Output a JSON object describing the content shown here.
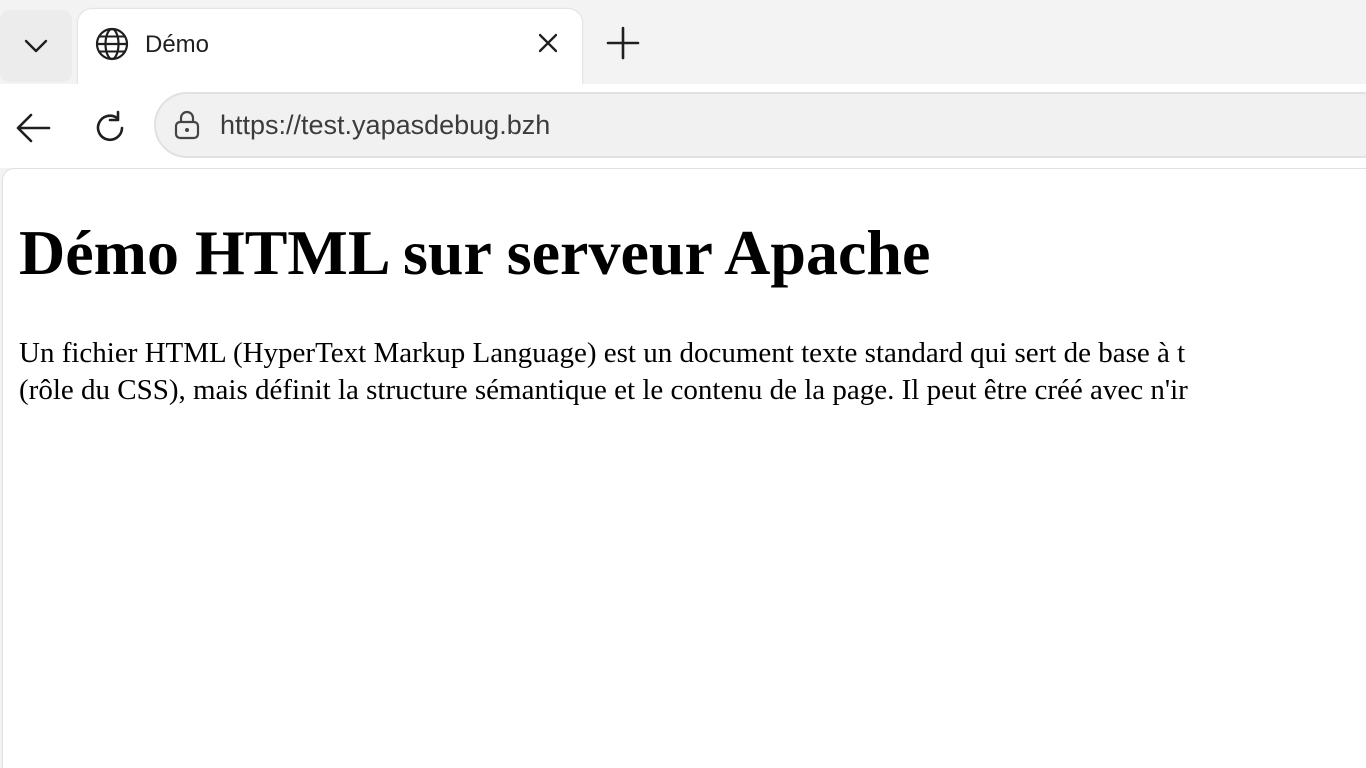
{
  "browser": {
    "tab": {
      "title": "Démo"
    },
    "address_bar": {
      "url": "https://test.yapasdebug.bzh"
    },
    "icons": {
      "tab_menu": "chevron-down-icon",
      "favicon": "globe-icon",
      "close": "close-icon",
      "new_tab": "plus-icon",
      "back": "arrow-left-icon",
      "reload": "reload-icon",
      "site_info": "lock-icon"
    }
  },
  "page": {
    "heading": "Démo HTML sur serveur Apache",
    "paragraph_lines": [
      "Un fichier HTML (HyperText Markup Language) est un document texte standard qui sert de base à t",
      "(rôle du CSS), mais définit la structure sémantique et le contenu de la page. Il peut être créé avec n'ir"
    ]
  }
}
